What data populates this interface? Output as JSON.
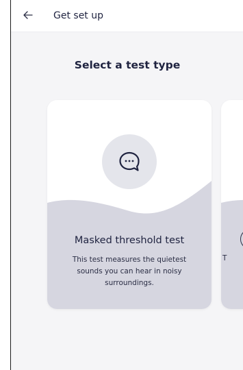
{
  "header": {
    "back_icon": "arrow-left-icon",
    "title": "Get set up"
  },
  "main": {
    "heading": "Select a test type",
    "cards": [
      {
        "icon": "chat-bubble-icon",
        "title": "Masked threshold test",
        "description": "This test measures the quietest sounds you can hear in noisy surroundings."
      },
      {
        "peek_text": "T"
      }
    ]
  },
  "colors": {
    "background": "#f5f5f7",
    "card": "#ffffff",
    "wave": "#d6d6e0",
    "text": "#1f2340"
  }
}
